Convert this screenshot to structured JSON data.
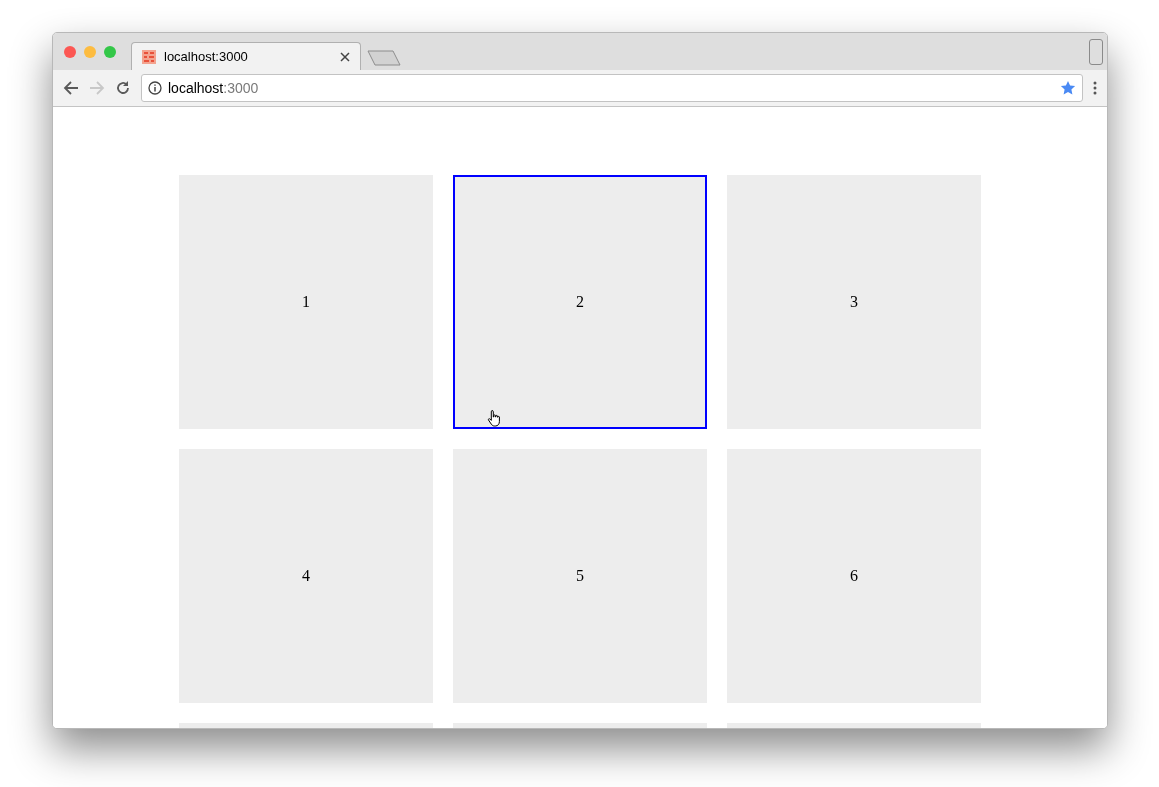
{
  "tab": {
    "title": "localhost:3000",
    "selected": true
  },
  "address_bar": {
    "host": "localhost",
    "port": ":3000"
  },
  "tiles": [
    {
      "label": "1",
      "selected": false
    },
    {
      "label": "2",
      "selected": true
    },
    {
      "label": "3",
      "selected": false
    },
    {
      "label": "4",
      "selected": false
    },
    {
      "label": "5",
      "selected": false
    },
    {
      "label": "6",
      "selected": false
    },
    {
      "selected": false
    },
    {
      "selected": false
    },
    {
      "selected": false
    }
  ]
}
